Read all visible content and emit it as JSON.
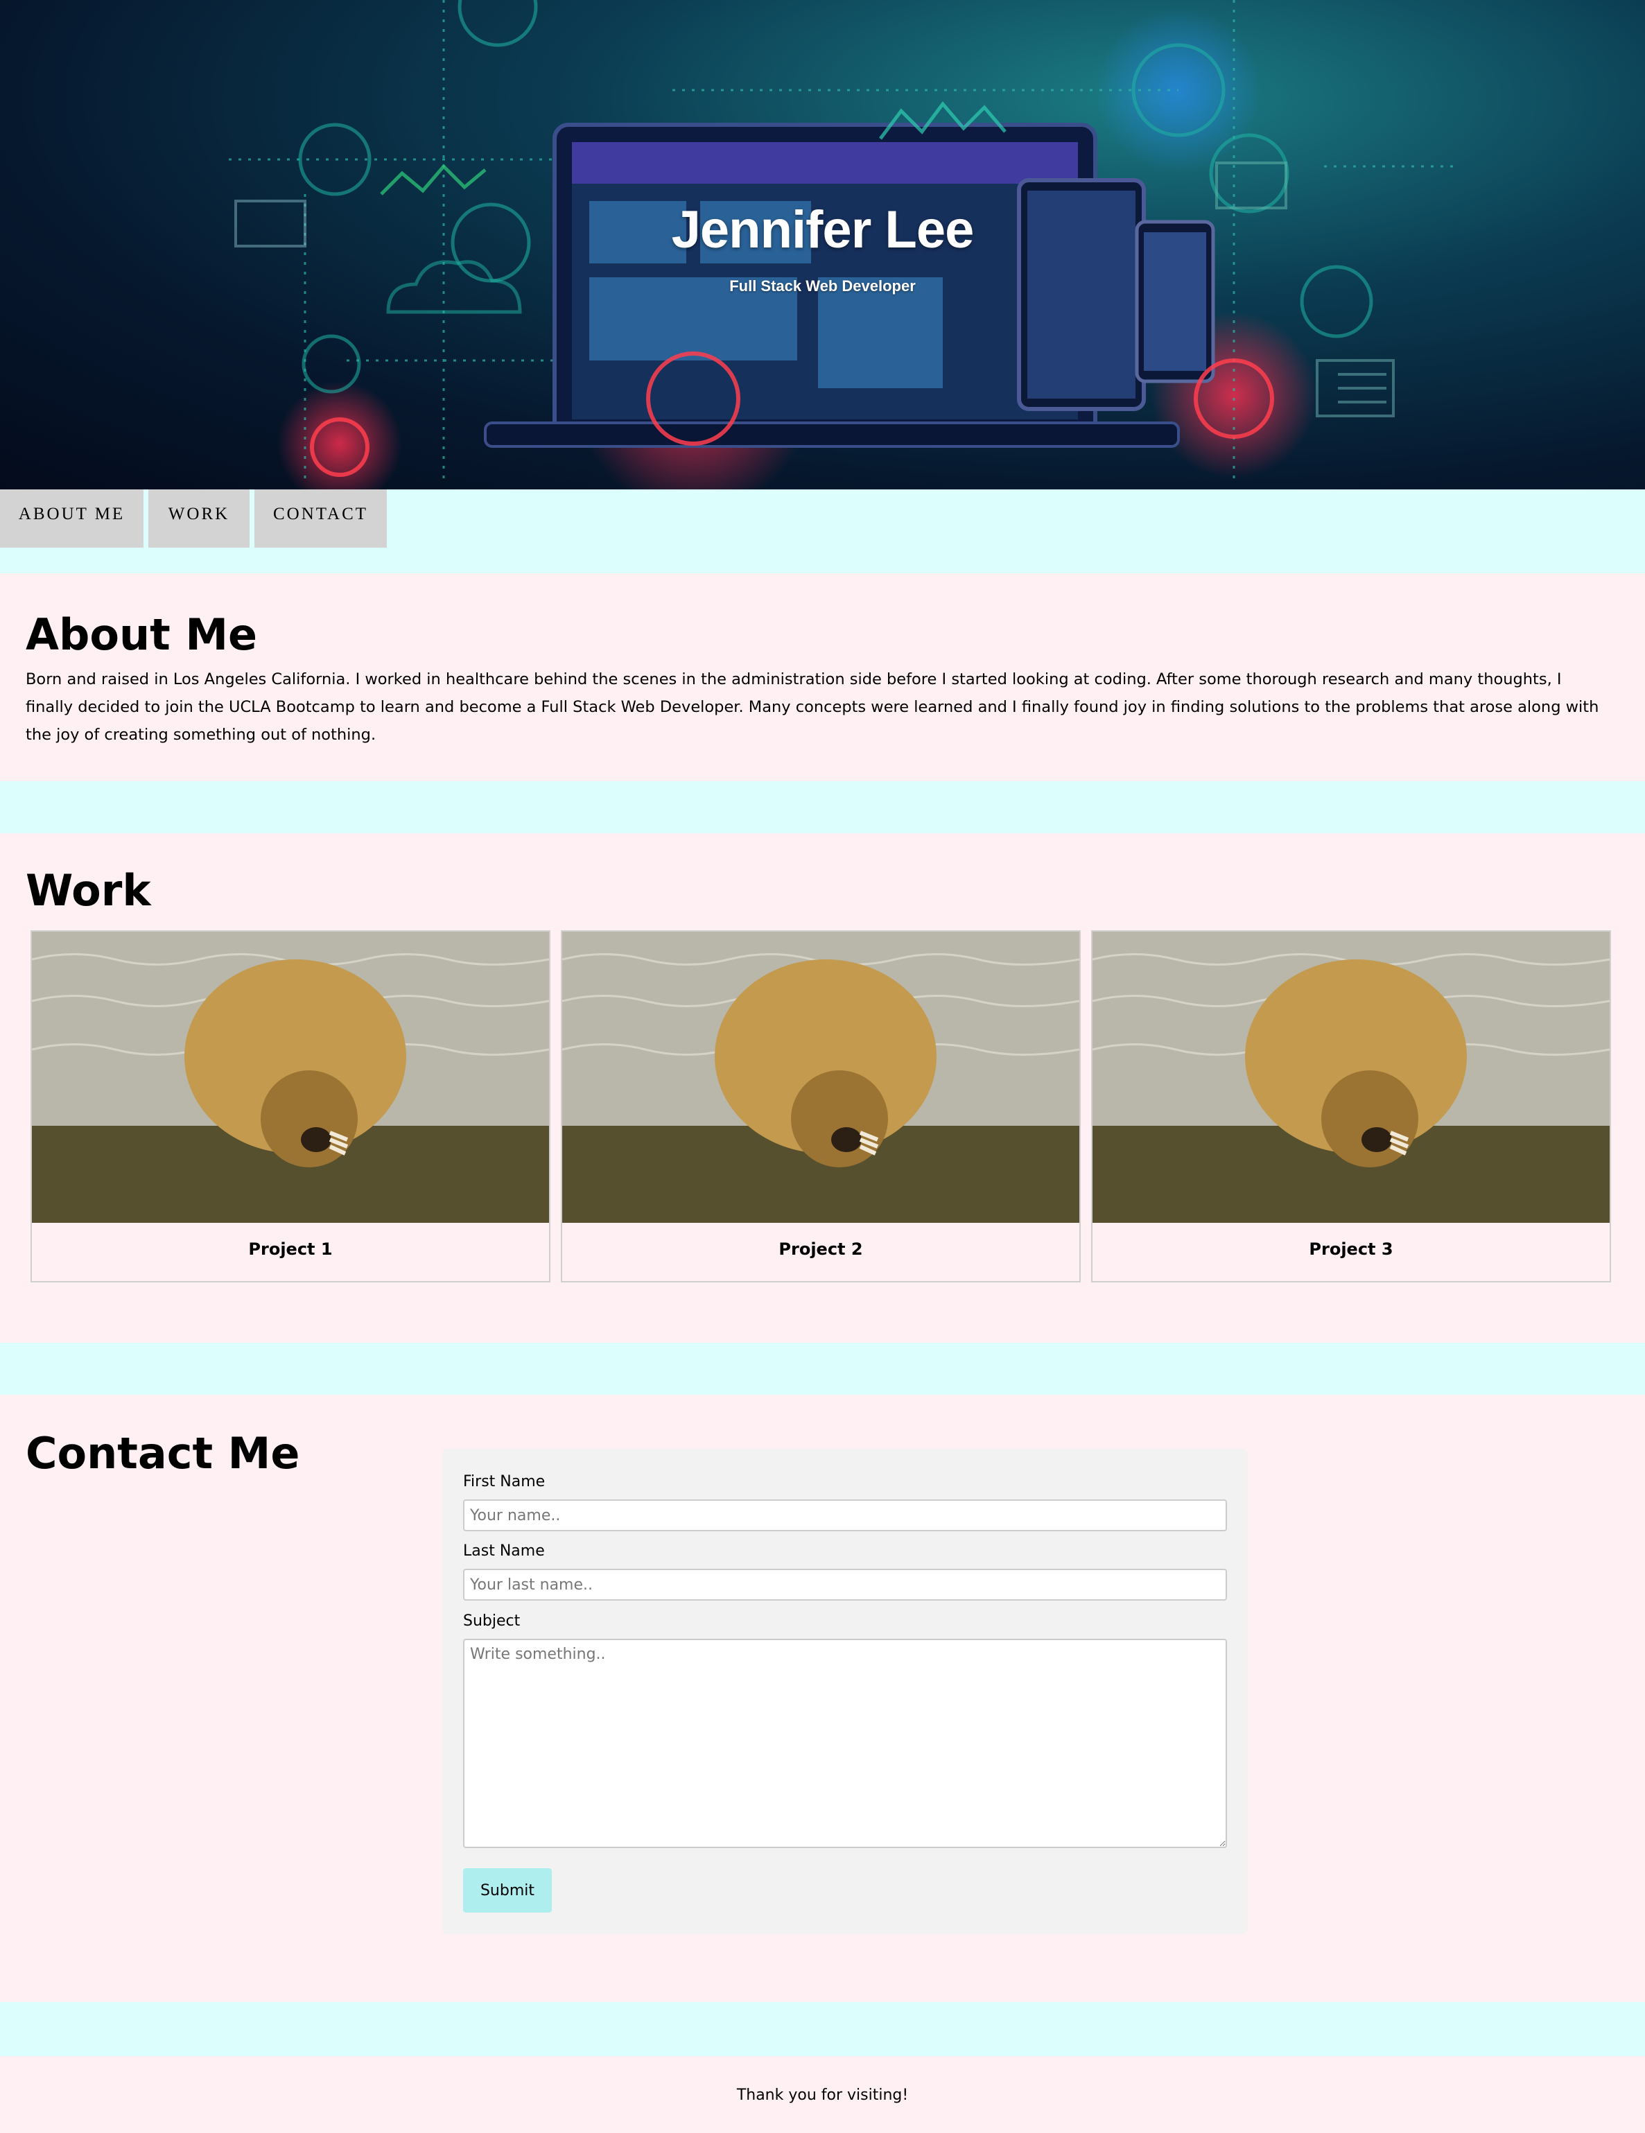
{
  "hero": {
    "name": "Jennifer Lee",
    "subtitle": "Full Stack Web Developer"
  },
  "nav": {
    "items": [
      {
        "label": "ABOUT ME"
      },
      {
        "label": "WORK"
      },
      {
        "label": "CONTACT"
      }
    ]
  },
  "about": {
    "heading": "About Me",
    "text": "Born and raised in Los Angeles California. I worked in healthcare behind the scenes in the administration side before I started looking at coding. After some thorough research and many thoughts, I finally decided to join the UCLA Bootcamp to learn and become a Full Stack Web Developer. Many concepts were learned and I finally found joy in finding solutions to the problems that arose along with the joy of creating something out of nothing."
  },
  "work": {
    "heading": "Work",
    "projects": [
      {
        "label": "Project 1"
      },
      {
        "label": "Project 2"
      },
      {
        "label": "Project 3"
      }
    ]
  },
  "contact": {
    "heading": "Contact Me",
    "first_name_label": "First Name",
    "first_name_placeholder": "Your name..",
    "last_name_label": "Last Name",
    "last_name_placeholder": "Your last name..",
    "subject_label": "Subject",
    "subject_placeholder": "Write something..",
    "submit_label": "Submit"
  },
  "footer": {
    "text": "Thank you for visiting!"
  },
  "colors": {
    "page_background": "#dcfffe",
    "section_background": "#fff0f4",
    "nav_background": "#d3d3d3",
    "form_background": "#f2f2f2",
    "submit_button": "#afeeee"
  }
}
